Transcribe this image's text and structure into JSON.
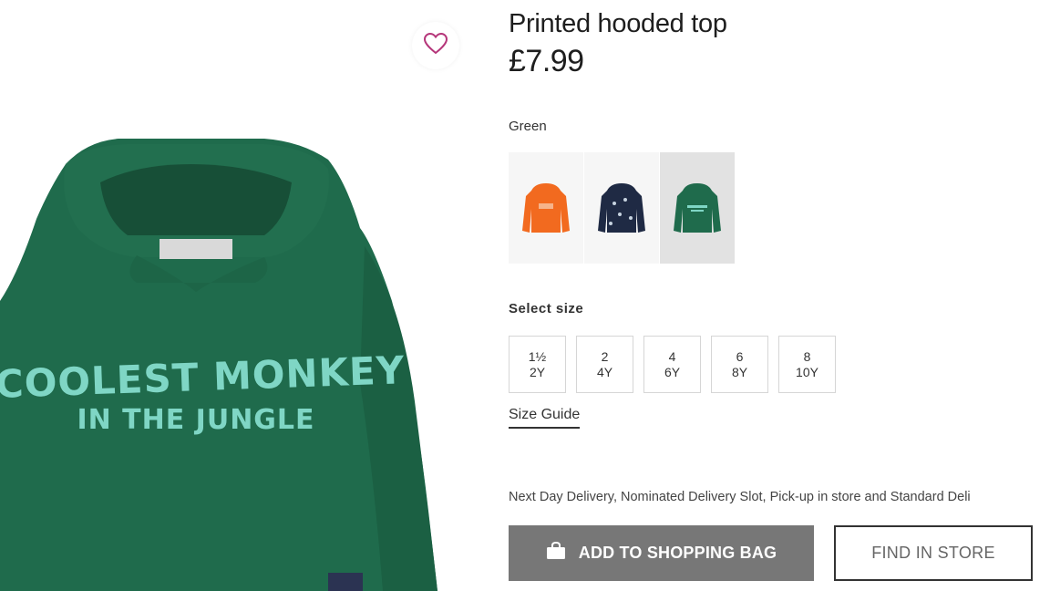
{
  "product": {
    "title": "Printed hooded top",
    "price": "£7.99",
    "image_text_line1": "COOLEST MONKEY",
    "image_text_line2": "IN THE JUNGLE"
  },
  "wishlist": {
    "icon": "heart-icon"
  },
  "color": {
    "selected_name": "Green",
    "swatches": [
      {
        "name": "orange",
        "color": "#f26a1f",
        "selected": false
      },
      {
        "name": "navy",
        "color": "#1f2a44",
        "selected": false
      },
      {
        "name": "green",
        "color": "#1f6b4c",
        "selected": true
      }
    ]
  },
  "size": {
    "label": "Select size",
    "options": [
      {
        "line1": "1½",
        "line2": "2Y"
      },
      {
        "line1": "2",
        "line2": "4Y"
      },
      {
        "line1": "4",
        "line2": "6Y"
      },
      {
        "line1": "6",
        "line2": "8Y"
      },
      {
        "line1": "8",
        "line2": "10Y"
      }
    ],
    "guide_label": "Size Guide"
  },
  "delivery_text": "Next Day Delivery, Nominated Delivery Slot, Pick-up in store and Standard Deli",
  "actions": {
    "add_to_bag": "ADD TO SHOPPING BAG",
    "add_to_bag_icon": "shopping-bag-icon",
    "find_in_store": "FIND IN STORE"
  },
  "colors": {
    "hoodie_green": "#1f6b4c",
    "print_text": "#7fd6c5",
    "primary_button": "#777777"
  }
}
